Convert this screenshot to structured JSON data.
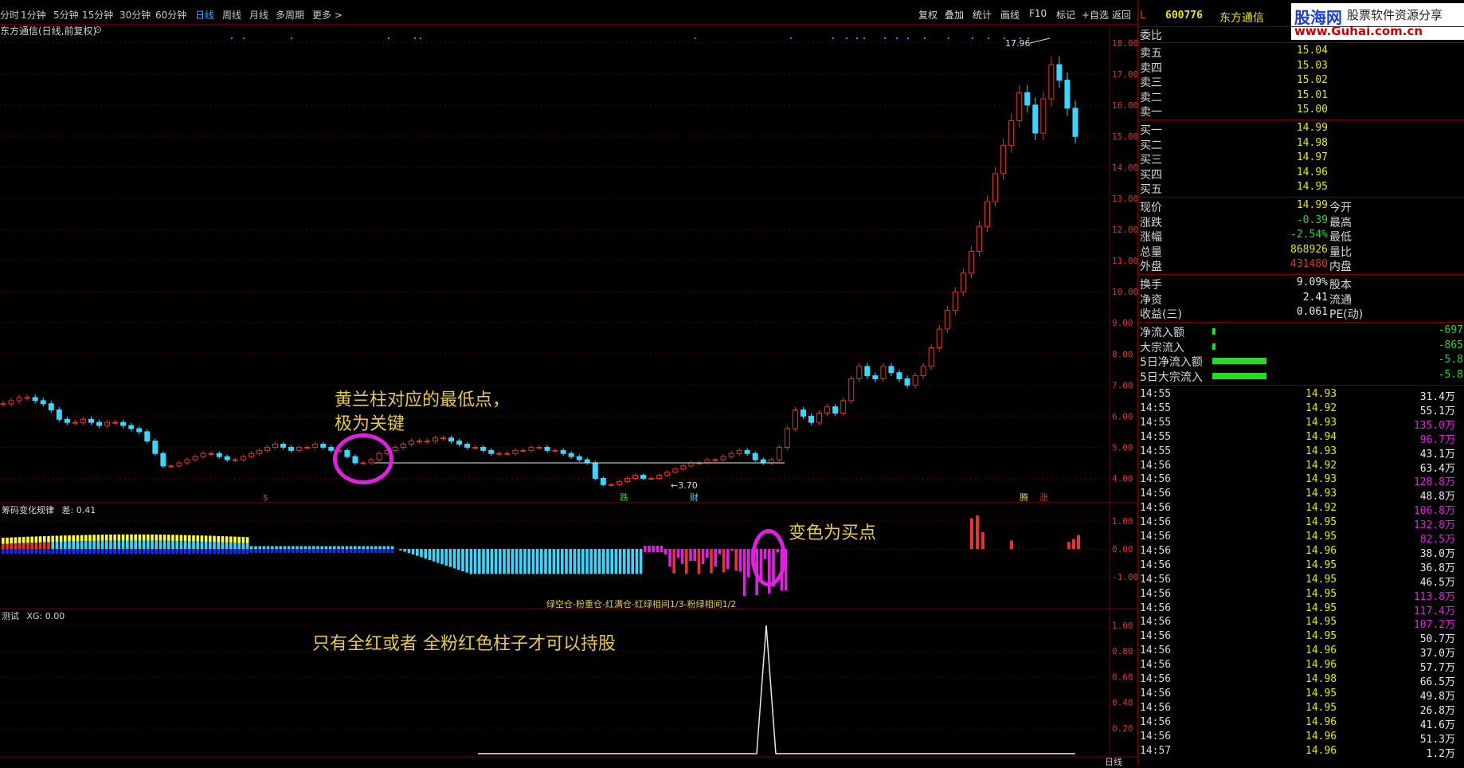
{
  "toolbar": {
    "periods": [
      {
        "label": "分时",
        "active": false
      },
      {
        "label": "1分钟",
        "active": false
      },
      {
        "label": "5分钟",
        "active": false
      },
      {
        "label": "15分钟",
        "active": false
      },
      {
        "label": "30分钟",
        "active": false
      },
      {
        "label": "60分钟",
        "active": false
      },
      {
        "label": "日线",
        "active": true
      },
      {
        "label": "周线",
        "active": false
      },
      {
        "label": "月线",
        "active": false
      },
      {
        "label": "多周期",
        "active": false
      },
      {
        "label": "更多 >",
        "active": false
      }
    ],
    "right_buttons": [
      "复权",
      "叠加",
      "统计",
      "画线",
      "F10",
      "标记",
      "+自选",
      "返回"
    ]
  },
  "chart": {
    "title": "东方通信(日线,前复权)",
    "y_ticks": [
      "18.00",
      "17.00",
      "16.00",
      "15.00",
      "14.00",
      "13.00",
      "12.00",
      "11.00",
      "10.00",
      "9.00",
      "8.00",
      "7.00",
      "6.00",
      "5.00",
      "4.00"
    ],
    "high_label": "17.96",
    "low_label": "3.70",
    "marks": [
      "$",
      "跌",
      "财",
      "腾",
      "涨"
    ],
    "annotation": "黄兰柱对应的最低点，\n极为关键"
  },
  "chart_data": {
    "type": "candlestick",
    "y_range": [
      3.5,
      18.2
    ],
    "closes": [
      6.4,
      6.5,
      6.6,
      6.6,
      6.5,
      6.4,
      6.2,
      5.9,
      5.8,
      5.8,
      5.9,
      5.8,
      5.7,
      5.8,
      5.8,
      5.7,
      5.6,
      5.5,
      5.2,
      4.8,
      4.4,
      4.4,
      4.5,
      4.6,
      4.7,
      4.8,
      4.8,
      4.7,
      4.6,
      4.6,
      4.7,
      4.8,
      4.9,
      5.0,
      5.1,
      5.0,
      4.9,
      5.0,
      5.0,
      5.1,
      5.0,
      4.9,
      4.9,
      4.7,
      4.5,
      4.5,
      4.6,
      4.8,
      4.9,
      5.0,
      5.1,
      5.2,
      5.2,
      5.2,
      5.3,
      5.3,
      5.2,
      5.1,
      5.0,
      5.0,
      4.9,
      4.8,
      4.8,
      4.8,
      4.9,
      4.9,
      5.0,
      5.0,
      4.9,
      4.9,
      4.8,
      4.7,
      4.6,
      4.5,
      4.0,
      3.8,
      3.8,
      3.9,
      4.0,
      4.1,
      4.0,
      4.0,
      4.1,
      4.2,
      4.3,
      4.4,
      4.5,
      4.5,
      4.6,
      4.6,
      4.7,
      4.8,
      4.9,
      4.8,
      4.6,
      4.5,
      4.6,
      5.0,
      5.6,
      6.2,
      6.0,
      5.8,
      6.1,
      6.3,
      6.1,
      6.5,
      7.2,
      7.6,
      7.3,
      7.2,
      7.6,
      7.4,
      7.2,
      7.0,
      7.3,
      7.6,
      8.2,
      8.8,
      9.4,
      10.0,
      10.6,
      11.3,
      12.1,
      12.9,
      13.8,
      14.7,
      15.5,
      16.4,
      16.0,
      15.1,
      16.2,
      17.3,
      16.8,
      15.9,
      14.99
    ],
    "indicator1": {
      "name": "筹码变化规律",
      "diff_label": "差: 0.41",
      "y_ticks": [
        "1.00",
        "0.00",
        "-1.00"
      ],
      "legend": "绿空仓-粉重仓-红满仓-红绿相间1/3-粉绿相间1/2",
      "annotation": "变色为买点"
    },
    "indicator2": {
      "name": "测试",
      "value_label": "XG: 0.00",
      "y_ticks": [
        "1.00",
        "0.80",
        "0.60",
        "0.40",
        "0.20"
      ],
      "annotation": "只有全红或者 全粉红色柱子才可以持股"
    }
  },
  "right_panel": {
    "header": {
      "flag": "L",
      "code": "600776",
      "name": "东方通信"
    },
    "logo": {
      "site": "股海网",
      "slogan": "股票软件资源分享",
      "url": "www.Guhai.com.cn"
    },
    "weibi_label": "委比",
    "asks": [
      {
        "label": "卖五",
        "price": "15.04"
      },
      {
        "label": "卖四",
        "price": "15.03"
      },
      {
        "label": "卖三",
        "price": "15.02"
      },
      {
        "label": "卖二",
        "price": "15.01"
      },
      {
        "label": "卖一",
        "price": "15.00"
      }
    ],
    "bids": [
      {
        "label": "买一",
        "price": "14.99"
      },
      {
        "label": "买二",
        "price": "14.98"
      },
      {
        "label": "买三",
        "price": "14.97"
      },
      {
        "label": "买四",
        "price": "14.96"
      },
      {
        "label": "买五",
        "price": "14.95"
      }
    ],
    "quote": [
      {
        "label": "现价",
        "value": "14.99",
        "color": "#e8e800",
        "label2": "今开"
      },
      {
        "label": "涨跌",
        "value": "-0.39",
        "color": "#22dd22",
        "label2": "最高"
      },
      {
        "label": "涨幅",
        "value": "-2.54%",
        "color": "#22dd22",
        "label2": "最低"
      },
      {
        "label": "总量",
        "value": "868926",
        "color": "#e8e800",
        "label2": "量比"
      },
      {
        "label": "外盘",
        "value": "431480",
        "color": "#e3342f",
        "label2": "内盘"
      }
    ],
    "stats": [
      {
        "label": "换手",
        "value": "9.09%",
        "label2": "股本"
      },
      {
        "label": "净资",
        "value": "2.41",
        "label2": "流通"
      },
      {
        "label": "收益(三)",
        "value": "0.061",
        "label2": "PE(动)"
      }
    ],
    "flows": [
      {
        "label": "净流入额",
        "value": "-697",
        "fill": 0.05
      },
      {
        "label": "大宗流入",
        "value": "-865",
        "fill": 0.05
      },
      {
        "label": "5日净流入额",
        "value": "-5.8",
        "fill": 0.85
      },
      {
        "label": "5日大宗流入",
        "value": "-5.8",
        "fill": 0.85
      }
    ],
    "ticks": [
      {
        "t": "14:55",
        "p": "14.93",
        "v": "31.4万",
        "c": "#e8e8e8"
      },
      {
        "t": "14:55",
        "p": "14.92",
        "v": "55.1万",
        "c": "#e8e8e8"
      },
      {
        "t": "14:55",
        "p": "14.93",
        "v": "135.0万",
        "c": "#e020e0"
      },
      {
        "t": "14:55",
        "p": "14.94",
        "v": "96.7万",
        "c": "#e020e0"
      },
      {
        "t": "14:55",
        "p": "14.93",
        "v": "43.1万",
        "c": "#e8e8e8"
      },
      {
        "t": "14:56",
        "p": "14.92",
        "v": "63.4万",
        "c": "#e8e8e8"
      },
      {
        "t": "14:56",
        "p": "14.93",
        "v": "128.8万",
        "c": "#e020e0"
      },
      {
        "t": "14:56",
        "p": "14.93",
        "v": "48.8万",
        "c": "#e8e8e8"
      },
      {
        "t": "14:56",
        "p": "14.92",
        "v": "106.8万",
        "c": "#e020e0"
      },
      {
        "t": "14:56",
        "p": "14.95",
        "v": "132.8万",
        "c": "#e020e0"
      },
      {
        "t": "14:56",
        "p": "14.95",
        "v": "82.5万",
        "c": "#e020e0"
      },
      {
        "t": "14:56",
        "p": "14.96",
        "v": "38.0万",
        "c": "#e8e8e8"
      },
      {
        "t": "14:56",
        "p": "14.95",
        "v": "36.8万",
        "c": "#e8e8e8"
      },
      {
        "t": "14:56",
        "p": "14.95",
        "v": "46.5万",
        "c": "#e8e8e8"
      },
      {
        "t": "14:56",
        "p": "14.95",
        "v": "113.8万",
        "c": "#e020e0"
      },
      {
        "t": "14:56",
        "p": "14.95",
        "v": "117.4万",
        "c": "#e020e0"
      },
      {
        "t": "14:56",
        "p": "14.95",
        "v": "107.2万",
        "c": "#e020e0"
      },
      {
        "t": "14:56",
        "p": "14.95",
        "v": "50.7万",
        "c": "#e8e8e8"
      },
      {
        "t": "14:56",
        "p": "14.96",
        "v": "37.0万",
        "c": "#e8e8e8"
      },
      {
        "t": "14:56",
        "p": "14.96",
        "v": "57.7万",
        "c": "#e8e8e8"
      },
      {
        "t": "14:56",
        "p": "14.98",
        "v": "66.5万",
        "c": "#e8e8e8"
      },
      {
        "t": "14:56",
        "p": "14.95",
        "v": "49.8万",
        "c": "#e8e8e8"
      },
      {
        "t": "14:56",
        "p": "14.95",
        "v": "26.8万",
        "c": "#e8e8e8"
      },
      {
        "t": "14:56",
        "p": "14.96",
        "v": "41.6万",
        "c": "#e8e8e8"
      },
      {
        "t": "14:56",
        "p": "14.96",
        "v": "51.3万",
        "c": "#e8e8e8"
      },
      {
        "t": "14:57",
        "p": "14.96",
        "v": "1.2万",
        "c": "#e8e8e8"
      }
    ],
    "footer_tab": "日线"
  }
}
